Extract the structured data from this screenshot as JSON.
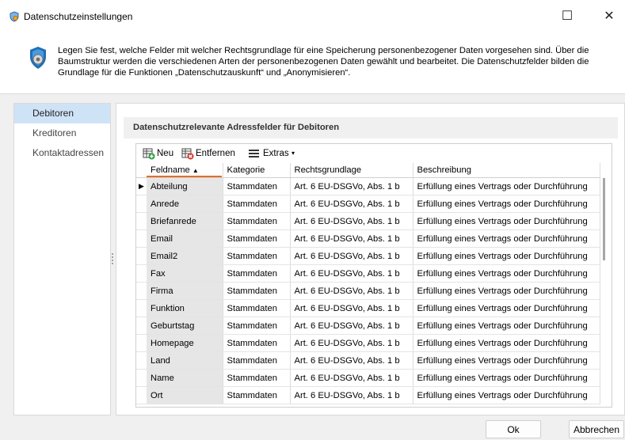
{
  "window": {
    "title": "Datenschutzeinstellungen",
    "maximize_glyph": "☐",
    "close_glyph": "✕"
  },
  "info": {
    "text": "Legen Sie fest, welche Felder mit welcher Rechtsgrundlage für eine Speicherung personenbezogener Daten vorgesehen sind. Über die Baumstruktur werden die verschiedenen Arten der personenbezogenen Daten gewählt und bearbeitet. Die Datenschutzfelder bilden die Grundlage für die Funktionen „Datenschutzauskunft“ und „Anonymisieren“."
  },
  "nav": {
    "items": [
      {
        "label": "Debitoren",
        "selected": true
      },
      {
        "label": "Kreditoren",
        "selected": false
      },
      {
        "label": "Kontaktadressen",
        "selected": false
      }
    ]
  },
  "section": {
    "title": "Datenschutzrelevante Adressfelder für Debitoren"
  },
  "toolbar": {
    "new_label": "Neu",
    "remove_label": "Entfernen",
    "extras_label": "Extras",
    "extras_arrow": "▾"
  },
  "grid": {
    "columns": [
      "Feldname",
      "Kategorie",
      "Rechtsgrundlage",
      "Beschreibung"
    ],
    "sort_arrow": "▲",
    "current_row_marker": "▶",
    "rows": [
      [
        "Abteilung",
        "Stammdaten",
        "Art. 6 EU-DSGVo, Abs. 1 b",
        "Erfüllung eines Vertrags oder Durchführung"
      ],
      [
        "Anrede",
        "Stammdaten",
        "Art. 6 EU-DSGVo, Abs. 1 b",
        "Erfüllung eines Vertrags oder Durchführung"
      ],
      [
        "Briefanrede",
        "Stammdaten",
        "Art. 6 EU-DSGVo, Abs. 1 b",
        "Erfüllung eines Vertrags oder Durchführung"
      ],
      [
        "Email",
        "Stammdaten",
        "Art. 6 EU-DSGVo, Abs. 1 b",
        "Erfüllung eines Vertrags oder Durchführung"
      ],
      [
        "Email2",
        "Stammdaten",
        "Art. 6 EU-DSGVo, Abs. 1 b",
        "Erfüllung eines Vertrags oder Durchführung"
      ],
      [
        "Fax",
        "Stammdaten",
        "Art. 6 EU-DSGVo, Abs. 1 b",
        "Erfüllung eines Vertrags oder Durchführung"
      ],
      [
        "Firma",
        "Stammdaten",
        "Art. 6 EU-DSGVo, Abs. 1 b",
        "Erfüllung eines Vertrags oder Durchführung"
      ],
      [
        "Funktion",
        "Stammdaten",
        "Art. 6 EU-DSGVo, Abs. 1 b",
        "Erfüllung eines Vertrags oder Durchführung"
      ],
      [
        "Geburtstag",
        "Stammdaten",
        "Art. 6 EU-DSGVo, Abs. 1 b",
        "Erfüllung eines Vertrags oder Durchführung"
      ],
      [
        "Homepage",
        "Stammdaten",
        "Art. 6 EU-DSGVo, Abs. 1 b",
        "Erfüllung eines Vertrags oder Durchführung"
      ],
      [
        "Land",
        "Stammdaten",
        "Art. 6 EU-DSGVo, Abs. 1 b",
        "Erfüllung eines Vertrags oder Durchführung"
      ],
      [
        "Name",
        "Stammdaten",
        "Art. 6 EU-DSGVo, Abs. 1 b",
        "Erfüllung eines Vertrags oder Durchführung"
      ],
      [
        "Ort",
        "Stammdaten",
        "Art. 6 EU-DSGVo, Abs. 1 b",
        "Erfüllung eines Vertrags oder Durchführung"
      ]
    ]
  },
  "buttons": {
    "ok_label": "Ok",
    "cancel_label": "Abbrechen"
  },
  "colors": {
    "selection": "#cfe3f7",
    "accent": "#e36c2a",
    "shield": "#1f6fb5"
  },
  "icons": {
    "app": "shield-gear-icon",
    "info": "shield-gear-icon",
    "new": "add-row-icon",
    "remove": "delete-row-icon",
    "extras": "menu-icon"
  }
}
